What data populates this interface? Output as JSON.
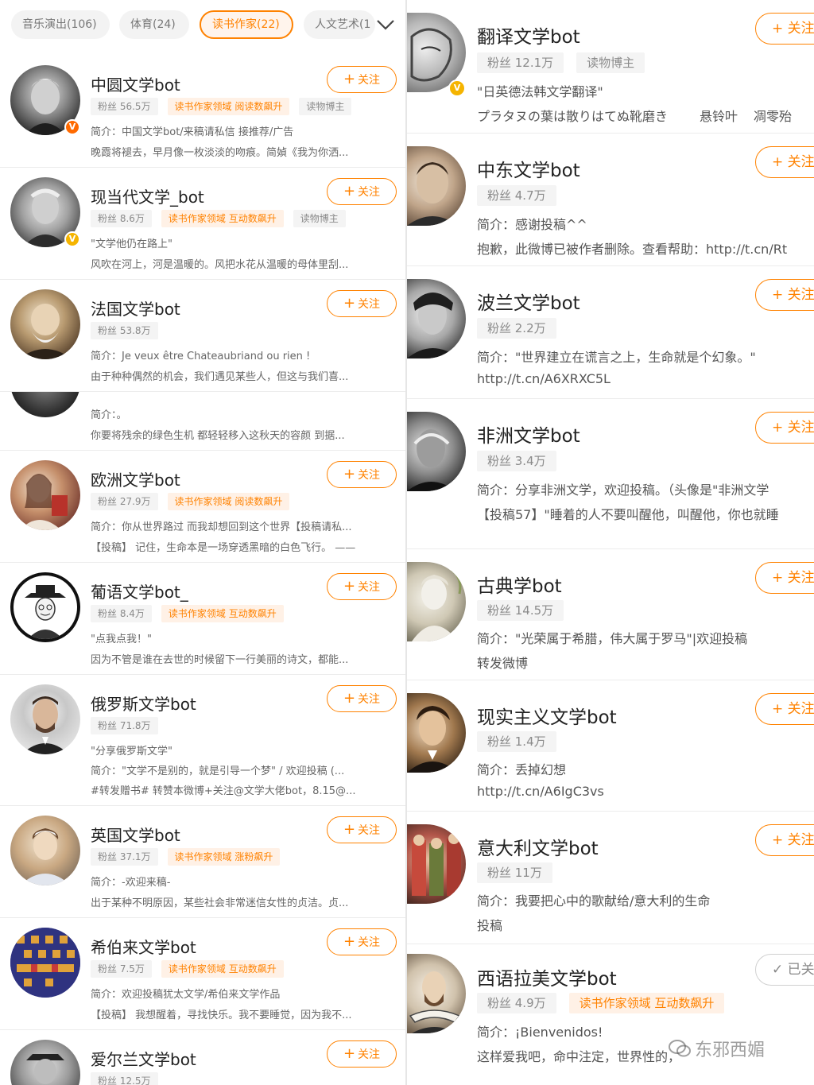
{
  "tabs": [
    {
      "label": "音乐演出(106)"
    },
    {
      "label": "体育(24)"
    },
    {
      "label": "读书作家(22)",
      "active": true
    },
    {
      "label": "人文艺术(1"
    }
  ],
  "left_cards": [
    {
      "name": "中圆文学bot",
      "badge": "red",
      "tags": [
        {
          "text": "粉丝 56.5万"
        },
        {
          "text": "读书作家领域 阅读数飙升",
          "orange": true
        },
        {
          "text": "读物博主"
        }
      ],
      "lines": [
        "简介：中国文学bot/来稿请私信 接推荐/广告",
        "晚霞将褪去，早月像一枚淡淡的吻痕。简媜《我为你洒..."
      ]
    },
    {
      "name": "现当代文学_bot",
      "badge": "gold",
      "tags": [
        {
          "text": "粉丝 8.6万"
        },
        {
          "text": "读书作家领域 互动数飙升",
          "orange": true
        },
        {
          "text": "读物博主"
        }
      ],
      "lines": [
        "\"文学他仍在路上\"",
        "风吹在河上，河是温暖的。风把水花从温暖的母体里刮..."
      ]
    },
    {
      "name": "法国文学bot",
      "badge": "",
      "tags": [
        {
          "text": "粉丝 53.8万"
        }
      ],
      "lines": [
        "简介：Je veux être Chateaubriand ou rien !",
        "由于种种偶然的机会，我们遇见某些人，但这与我们喜..."
      ]
    },
    {
      "name": "",
      "badge": "",
      "tags": [],
      "lines": [
        "简介：。",
        "你要将残余的绿色生机 都轻轻移入这秋天的容颜 到据..."
      ]
    },
    {
      "name": "欧洲文学bot",
      "badge": "",
      "tags": [
        {
          "text": "粉丝 27.9万"
        },
        {
          "text": "读书作家领域 阅读数飙升",
          "orange": true
        }
      ],
      "lines": [
        "简介：你从世界路过 而我却想回到这个世界【投稿请私...",
        "【投稿】 记住，生命本是一场穿透黑暗的白色飞行。 ——"
      ]
    },
    {
      "name": "葡语文学bot_",
      "badge": "",
      "tags": [
        {
          "text": "粉丝 8.4万"
        },
        {
          "text": "读书作家领域 互动数飙升",
          "orange": true
        }
      ],
      "lines": [
        "\"点我点我！\"",
        "因为不管是谁在去世的时候留下一行美丽的诗文，都能..."
      ]
    },
    {
      "name": "俄罗斯文学bot",
      "badge": "",
      "tags": [
        {
          "text": "粉丝 71.8万"
        }
      ],
      "lines": [
        "\"分享俄罗斯文学\"",
        "简介：\"文学不是别的，就是引导一个梦\" / 欢迎投稿 (...",
        "#转发赠书# 转赞本微博+关注@文学大佬bot，8.15@..."
      ]
    },
    {
      "name": "英国文学bot",
      "badge": "",
      "tags": [
        {
          "text": "粉丝 37.1万"
        },
        {
          "text": "读书作家领域 涨粉飙升",
          "orange": true
        }
      ],
      "lines": [
        "简介：-欢迎来稿-",
        "出于某种不明原因，某些社会非常迷信女性的贞洁。贞..."
      ]
    },
    {
      "name": "希伯来文学bot",
      "badge": "",
      "tags": [
        {
          "text": "粉丝 7.5万"
        },
        {
          "text": "读书作家领域 互动数飙升",
          "orange": true
        }
      ],
      "lines": [
        "简介：欢迎投稿犹太文学/希伯来文学作品",
        "【投稿】 我想醒着，寻找快乐。我不要睡觉，因为我不..."
      ]
    },
    {
      "name": "爱尔兰文学bot",
      "badge": "",
      "tags": [
        {
          "text": "粉丝 12.5万"
        }
      ],
      "lines": []
    }
  ],
  "right_cards": [
    {
      "name": "翻译文学bot",
      "badge": "gold",
      "follow": "+ 关注",
      "tags": [
        {
          "text": "粉丝 12.1万"
        },
        {
          "text": "读物博主"
        }
      ],
      "lines": [
        [
          "\"日英德法韩文学翻译\""
        ],
        [
          "プラタヌの葉は散りはてぬ靴磨き",
          "悬铃叶",
          "凋零殆"
        ]
      ]
    },
    {
      "name": "中东文学bot",
      "badge": "",
      "follow": "+ 关注",
      "tags": [
        {
          "text": "粉丝 4.7万"
        }
      ],
      "lines": [
        [
          "简介：感谢投稿^^"
        ],
        [
          "抱歉，此微博已被作者删除。查看帮助：http://t.cn/Rt"
        ]
      ]
    },
    {
      "name": "波兰文学bot",
      "badge": "",
      "follow": "+ 关注",
      "tags": [
        {
          "text": "粉丝 2.2万"
        }
      ],
      "lines": [
        [
          "简介：\"世界建立在谎言之上，生命就是个幻象。\""
        ],
        [
          "http://t.cn/A6XRXC5L"
        ]
      ]
    },
    {
      "name": "非洲文学bot",
      "badge": "",
      "follow": "+ 关注",
      "tags": [
        {
          "text": "粉丝 3.4万"
        }
      ],
      "lines": [
        [
          "简介：分享非洲文学，欢迎投稿。（头像是\"非洲文学"
        ],
        [
          "【投稿57】\"睡着的人不要叫醒他，叫醒他，你也就睡"
        ]
      ]
    },
    {
      "name": "古典学bot",
      "badge": "",
      "follow": "+ 关注",
      "tags": [
        {
          "text": "粉丝 14.5万"
        }
      ],
      "lines": [
        [
          "简介：\"光荣属于希腊，伟大属于罗马\"|欢迎投稿"
        ],
        [
          "转发微博"
        ]
      ]
    },
    {
      "name": "现实主义文学bot",
      "badge": "",
      "follow": "+ 关注",
      "tags": [
        {
          "text": "粉丝 1.4万"
        }
      ],
      "lines": [
        [
          "简介：丢掉幻想"
        ],
        [
          "http://t.cn/A6IgC3vs"
        ]
      ]
    },
    {
      "name": "意大利文学bot",
      "badge": "",
      "follow": "+ 关注",
      "tags": [
        {
          "text": "粉丝 11万"
        }
      ],
      "lines": [
        [
          "简介：我要把心中的歌献给/意大利的生命"
        ],
        [
          "投稿"
        ]
      ]
    },
    {
      "name": "西语拉美文学bot",
      "badge": "",
      "follow": "✓ 已关注",
      "followed": true,
      "tags": [
        {
          "text": "粉丝 4.9万"
        },
        {
          "text": "读书作家领域 互动数飙升",
          "orange": true
        }
      ],
      "lines": [
        [
          "简介：¡Bienvenidos!"
        ],
        [
          "这样爱我吧，命中注定，世界性的，"
        ]
      ]
    }
  ],
  "follow_label": "关注",
  "watermark": "东邪西媚",
  "colors": {
    "accent": "#ff8200",
    "badge_red": "#ff6a00",
    "badge_gold": "#f5b400"
  }
}
